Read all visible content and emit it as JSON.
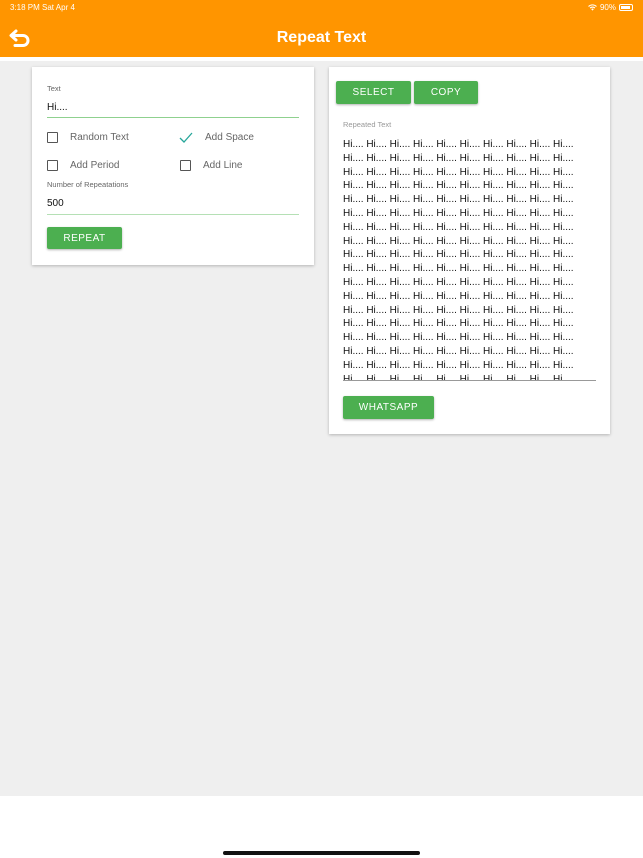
{
  "status": {
    "time": "3:18 PM  Sat Apr 4",
    "battery": "90%"
  },
  "header": {
    "title": "Repeat Text",
    "back_icon": "undo-arrow-icon"
  },
  "form": {
    "text_label": "Text",
    "text_value": "Hi....",
    "random_text": "Random Text",
    "add_space": "Add Space",
    "add_period": "Add Period",
    "add_line": "Add Line",
    "checked": {
      "random_text": false,
      "add_space": true,
      "add_period": false,
      "add_line": false
    },
    "count_label": "Number of Repeatations",
    "count_value": "500",
    "repeat_button": "REPEAT"
  },
  "output": {
    "select_button": "SELECT",
    "copy_button": "COPY",
    "label": "Repeated Text",
    "whatsapp_button": "WHATSAPP",
    "repeated_text": "Hi.... Hi.... Hi.... Hi.... Hi.... Hi.... Hi.... Hi.... Hi.... Hi.... Hi.... Hi.... Hi.... Hi.... Hi.... Hi.... Hi.... Hi.... Hi.... Hi.... Hi.... Hi.... Hi.... Hi.... Hi.... Hi.... Hi.... Hi.... Hi.... Hi.... Hi.... Hi.... Hi.... Hi.... Hi.... Hi.... Hi.... Hi.... Hi.... Hi.... Hi.... Hi.... Hi.... Hi.... Hi.... Hi.... Hi.... Hi.... Hi.... Hi.... Hi.... Hi.... Hi.... Hi.... Hi.... Hi.... Hi.... Hi.... Hi.... Hi.... Hi.... Hi.... Hi.... Hi.... Hi.... Hi.... Hi.... Hi.... Hi.... Hi.... Hi.... Hi.... Hi.... Hi.... Hi.... Hi.... Hi.... Hi.... Hi.... Hi.... Hi.... Hi.... Hi.... Hi.... Hi.... Hi.... Hi.... Hi.... Hi.... Hi.... Hi.... Hi.... Hi.... Hi.... Hi.... Hi.... Hi.... Hi.... Hi.... Hi.... Hi.... Hi.... Hi.... Hi.... Hi.... Hi.... Hi.... Hi.... Hi.... Hi.... Hi.... Hi.... Hi.... Hi.... Hi.... Hi.... Hi.... Hi.... Hi.... Hi.... Hi.... Hi.... Hi.... Hi.... Hi.... Hi.... Hi.... Hi.... Hi.... Hi.... Hi.... Hi.... Hi.... Hi.... Hi.... Hi.... Hi.... Hi.... Hi.... Hi.... Hi.... Hi.... Hi.... Hi.... Hi.... Hi.... Hi.... Hi.... Hi.... Hi.... Hi.... Hi.... Hi.... Hi.... Hi.... Hi.... Hi.... Hi.... Hi.... Hi.... Hi.... Hi.... Hi.... Hi.... Hi.... Hi.... Hi.... Hi.... Hi.... Hi.... Hi.... Hi.... Hi.... Hi.... Hi.... Hi.... Hi.... Hi.... Hi.... Hi.... Hi.... Hi.... Hi.... Hi.... Hi.... Hi.... Hi.... Hi.... Hi.... Hi.... Hi.... Hi.... Hi.... Hi.... Hi.... Hi.... Hi.... Hi.... Hi.... Hi.... Hi.... Hi.... Hi.... Hi.... Hi.... Hi.... Hi.... Hi.... Hi.... Hi.... Hi.... Hi.... Hi.... Hi.... Hi.... Hi.... Hi.... Hi.... Hi.... Hi.... Hi.... Hi.... Hi.... Hi...."
  },
  "colors": {
    "accent": "#ff9500",
    "button": "#4caf50",
    "check": "#26a69a"
  }
}
